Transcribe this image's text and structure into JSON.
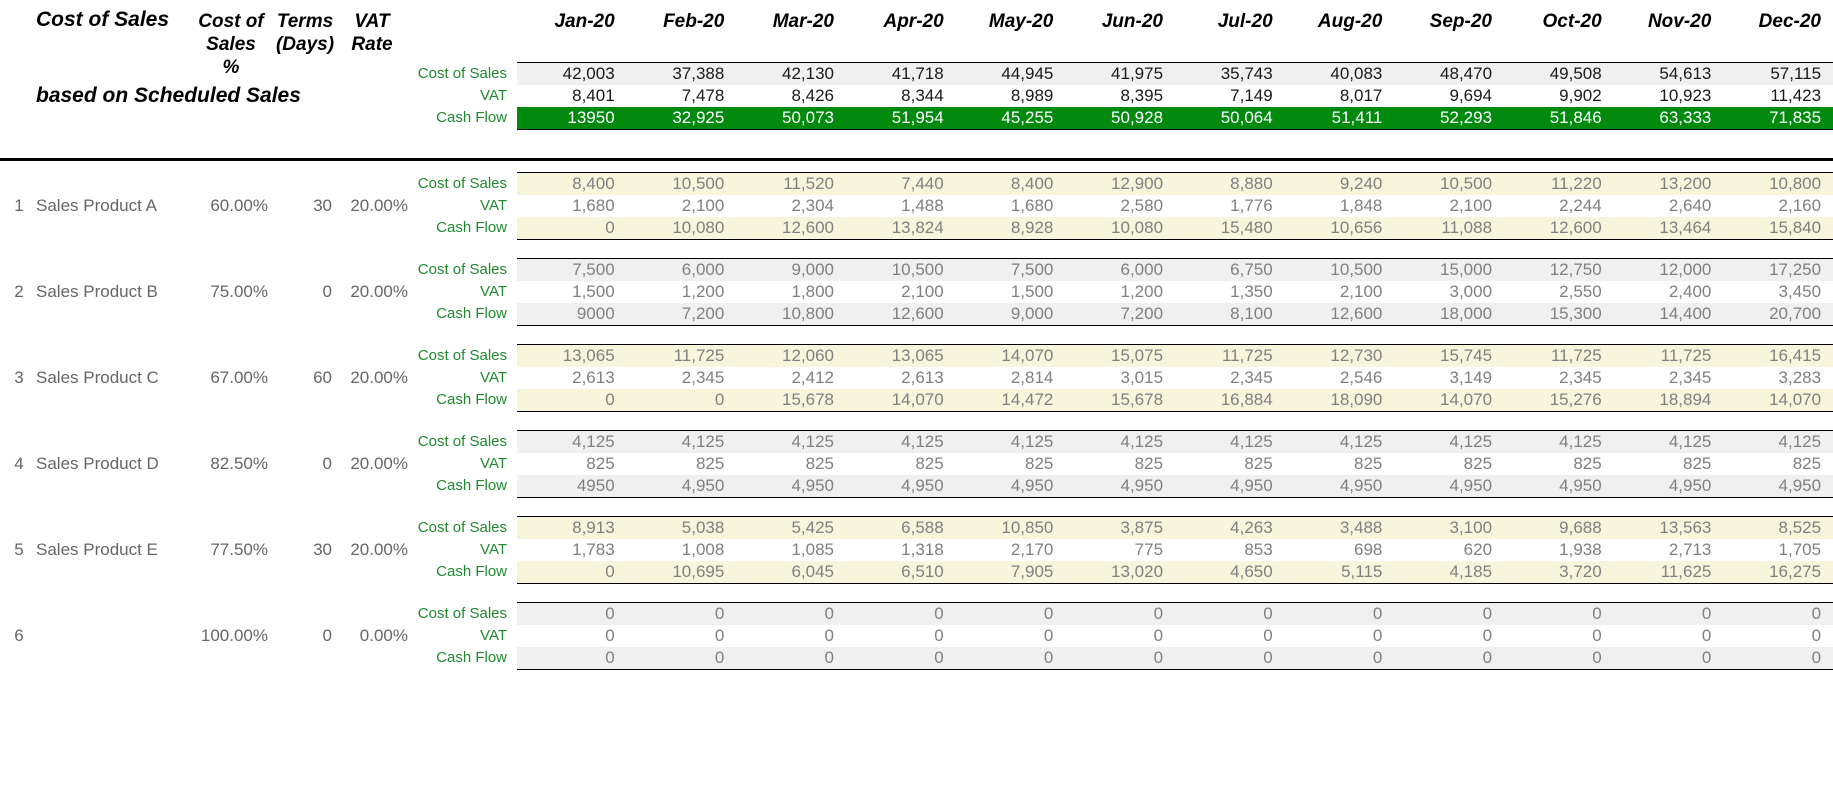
{
  "header": {
    "title": "Cost of Sales",
    "subtitle": "based on Scheduled Sales",
    "col_cos_pct": "Cost of\nSales %",
    "col_cos_pct_l1": "Cost of",
    "col_cos_pct_l2": "Sales %",
    "col_terms_l1": "Terms",
    "col_terms_l2": "(Days)",
    "col_vat_l1": "VAT",
    "col_vat_l2": "Rate",
    "months": [
      "Jan-20",
      "Feb-20",
      "Mar-20",
      "Apr-20",
      "May-20",
      "Jun-20",
      "Jul-20",
      "Aug-20",
      "Sep-20",
      "Oct-20",
      "Nov-20",
      "Dec-20"
    ]
  },
  "row_labels": {
    "cost_of_sales": "Cost of Sales",
    "vat": "VAT",
    "cash_flow": "Cash Flow"
  },
  "colors": {
    "label_green": "#1f8a2e",
    "cashflow_green_bg": "#028a0f",
    "cream": "#f7f5dc",
    "grey": "#f0f0f0",
    "value_grey": "#808080",
    "value_dark": "#1a1a1a"
  },
  "summary": {
    "cost_of_sales": [
      "42,003",
      "37,388",
      "42,130",
      "41,718",
      "44,945",
      "41,975",
      "35,743",
      "40,083",
      "48,470",
      "49,508",
      "54,613",
      "57,115"
    ],
    "vat": [
      "8,401",
      "7,478",
      "8,426",
      "8,344",
      "8,989",
      "8,395",
      "7,149",
      "8,017",
      "9,694",
      "9,902",
      "10,923",
      "11,423"
    ],
    "cash_flow": [
      "13950",
      "32,925",
      "50,073",
      "51,954",
      "45,255",
      "50,928",
      "50,064",
      "51,411",
      "52,293",
      "51,846",
      "63,333",
      "71,835"
    ]
  },
  "products": [
    {
      "index": "1",
      "name": "Sales Product A",
      "cos_pct": "60.00%",
      "terms": "30",
      "vat_rate": "20.00%",
      "cost_of_sales": [
        "8,400",
        "10,500",
        "11,520",
        "7,440",
        "8,400",
        "12,900",
        "8,880",
        "9,240",
        "10,500",
        "11,220",
        "13,200",
        "10,800"
      ],
      "vat": [
        "1,680",
        "2,100",
        "2,304",
        "1,488",
        "1,680",
        "2,580",
        "1,776",
        "1,848",
        "2,100",
        "2,244",
        "2,640",
        "2,160"
      ],
      "cash_flow": [
        "0",
        "10,080",
        "12,600",
        "13,824",
        "8,928",
        "10,080",
        "15,480",
        "10,656",
        "11,088",
        "12,600",
        "13,464",
        "15,840"
      ]
    },
    {
      "index": "2",
      "name": "Sales Product B",
      "cos_pct": "75.00%",
      "terms": "0",
      "vat_rate": "20.00%",
      "cost_of_sales": [
        "7,500",
        "6,000",
        "9,000",
        "10,500",
        "7,500",
        "6,000",
        "6,750",
        "10,500",
        "15,000",
        "12,750",
        "12,000",
        "17,250"
      ],
      "vat": [
        "1,500",
        "1,200",
        "1,800",
        "2,100",
        "1,500",
        "1,200",
        "1,350",
        "2,100",
        "3,000",
        "2,550",
        "2,400",
        "3,450"
      ],
      "cash_flow": [
        "9000",
        "7,200",
        "10,800",
        "12,600",
        "9,000",
        "7,200",
        "8,100",
        "12,600",
        "18,000",
        "15,300",
        "14,400",
        "20,700"
      ]
    },
    {
      "index": "3",
      "name": "Sales Product C",
      "cos_pct": "67.00%",
      "terms": "60",
      "vat_rate": "20.00%",
      "cost_of_sales": [
        "13,065",
        "11,725",
        "12,060",
        "13,065",
        "14,070",
        "15,075",
        "11,725",
        "12,730",
        "15,745",
        "11,725",
        "11,725",
        "16,415"
      ],
      "vat": [
        "2,613",
        "2,345",
        "2,412",
        "2,613",
        "2,814",
        "3,015",
        "2,345",
        "2,546",
        "3,149",
        "2,345",
        "2,345",
        "3,283"
      ],
      "cash_flow": [
        "0",
        "0",
        "15,678",
        "14,070",
        "14,472",
        "15,678",
        "16,884",
        "18,090",
        "14,070",
        "15,276",
        "18,894",
        "14,070"
      ]
    },
    {
      "index": "4",
      "name": "Sales Product D",
      "cos_pct": "82.50%",
      "terms": "0",
      "vat_rate": "20.00%",
      "cost_of_sales": [
        "4,125",
        "4,125",
        "4,125",
        "4,125",
        "4,125",
        "4,125",
        "4,125",
        "4,125",
        "4,125",
        "4,125",
        "4,125",
        "4,125"
      ],
      "vat": [
        "825",
        "825",
        "825",
        "825",
        "825",
        "825",
        "825",
        "825",
        "825",
        "825",
        "825",
        "825"
      ],
      "cash_flow": [
        "4950",
        "4,950",
        "4,950",
        "4,950",
        "4,950",
        "4,950",
        "4,950",
        "4,950",
        "4,950",
        "4,950",
        "4,950",
        "4,950"
      ]
    },
    {
      "index": "5",
      "name": "Sales Product E",
      "cos_pct": "77.50%",
      "terms": "30",
      "vat_rate": "20.00%",
      "cost_of_sales": [
        "8,913",
        "5,038",
        "5,425",
        "6,588",
        "10,850",
        "3,875",
        "4,263",
        "3,488",
        "3,100",
        "9,688",
        "13,563",
        "8,525"
      ],
      "vat": [
        "1,783",
        "1,008",
        "1,085",
        "1,318",
        "2,170",
        "775",
        "853",
        "698",
        "620",
        "1,938",
        "2,713",
        "1,705"
      ],
      "cash_flow": [
        "0",
        "10,695",
        "6,045",
        "6,510",
        "7,905",
        "13,020",
        "4,650",
        "5,115",
        "4,185",
        "3,720",
        "11,625",
        "16,275"
      ]
    },
    {
      "index": "6",
      "name": "",
      "cos_pct": "100.00%",
      "terms": "0",
      "vat_rate": "0.00%",
      "cost_of_sales": [
        "0",
        "0",
        "0",
        "0",
        "0",
        "0",
        "0",
        "0",
        "0",
        "0",
        "0",
        "0"
      ],
      "vat": [
        "0",
        "0",
        "0",
        "0",
        "0",
        "0",
        "0",
        "0",
        "0",
        "0",
        "0",
        "0"
      ],
      "cash_flow": [
        "0",
        "0",
        "0",
        "0",
        "0",
        "0",
        "0",
        "0",
        "0",
        "0",
        "0",
        "0"
      ]
    }
  ]
}
